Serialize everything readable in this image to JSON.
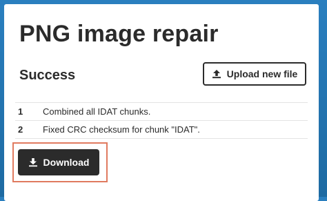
{
  "page": {
    "title": "PNG image repair",
    "status": "Success",
    "upload_label": "Upload new file",
    "download_label": "Download"
  },
  "log": [
    {
      "num": "1",
      "text": "Combined all IDAT chunks."
    },
    {
      "num": "2",
      "text": "Fixed CRC checksum for chunk \"IDAT\"."
    }
  ],
  "icons": {
    "upload": "upload-icon",
    "download": "download-icon"
  },
  "colors": {
    "highlight": "#e07a5f",
    "button_dark": "#2b2b2b"
  }
}
